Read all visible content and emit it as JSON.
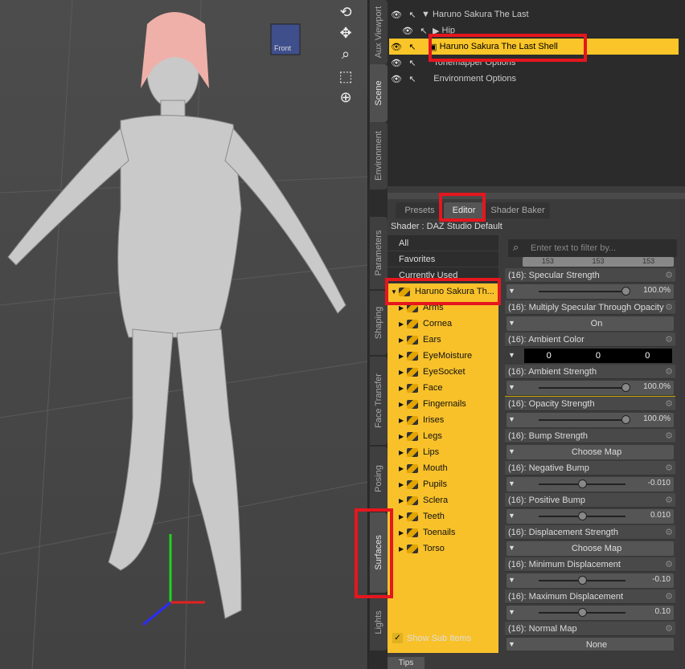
{
  "viewport": {
    "tools": [
      "rotate-icon",
      "move-icon",
      "zoom-icon",
      "frame-icon",
      "home-icon"
    ],
    "cube_label": "Front"
  },
  "side_tabs": [
    "Aux Viewport",
    "Scene",
    "Environment",
    "Parameters",
    "Shaping",
    "Face Transfer",
    "Posing",
    "Surfaces",
    "Lights"
  ],
  "scene": {
    "rows": [
      {
        "label": "Haruno Sakura The Last",
        "arrow": "▼"
      },
      {
        "label": "Hip",
        "arrow": "▶"
      },
      {
        "label": "Haruno Sakura The Last Shell",
        "arrow": ""
      },
      {
        "label": "Tonemapper Options",
        "arrow": ""
      },
      {
        "label": "Environment Options",
        "arrow": ""
      }
    ]
  },
  "surfaces": {
    "tabs": [
      "Presets",
      "Editor",
      "Shader Baker"
    ],
    "shader": "Shader : DAZ Studio Default",
    "filter_placeholder": "Enter text to filter by...",
    "tree_top": [
      "All",
      "Favorites",
      "Currently Used"
    ],
    "root": "Haruno Sakura Th...",
    "items": [
      "Arms",
      "Cornea",
      "Ears",
      "EyeMoisture",
      "EyeSocket",
      "Face",
      "Fingernails",
      "Irises",
      "Legs",
      "Lips",
      "Mouth",
      "Pupils",
      "Sclera",
      "Teeth",
      "Toenails",
      "Torso"
    ],
    "show_sub_items": "Show Sub Items",
    "props": [
      {
        "label": "(16): Specular Strength",
        "kind": "slider",
        "value": "100.0%",
        "fill": 1.0
      },
      {
        "label": "(16): Multiply Specular Through Opacity",
        "kind": "button",
        "value": "On"
      },
      {
        "label": "(16): Ambient Color",
        "kind": "color",
        "values": [
          "0",
          "0",
          "0"
        ]
      },
      {
        "label": "(16): Ambient Strength",
        "kind": "slider",
        "value": "100.0%",
        "fill": 1.0
      },
      {
        "label": "(16): Opacity Strength",
        "kind": "slider",
        "value": "100.0%",
        "fill": 1.0
      },
      {
        "label": "(16): Bump Strength",
        "kind": "button",
        "value": "Choose Map"
      },
      {
        "label": "(16): Negative Bump",
        "kind": "slider",
        "value": "-0.010",
        "fill": 0.5
      },
      {
        "label": "(16): Positive Bump",
        "kind": "slider",
        "value": "0.010",
        "fill": 0.5
      },
      {
        "label": "(16): Displacement Strength",
        "kind": "button",
        "value": "Choose Map"
      },
      {
        "label": "(16): Minimum Displacement",
        "kind": "slider",
        "value": "-0.10",
        "fill": 0.5
      },
      {
        "label": "(16): Maximum Displacement",
        "kind": "slider",
        "value": "0.10",
        "fill": 0.5
      },
      {
        "label": "(16): Normal Map",
        "kind": "button",
        "value": "None"
      }
    ],
    "top_color_values": [
      "153",
      "153",
      "153"
    ]
  },
  "bottom_tab": "Tips",
  "colors": {
    "selection": "#f9c528",
    "highlight": "#e5161e"
  }
}
